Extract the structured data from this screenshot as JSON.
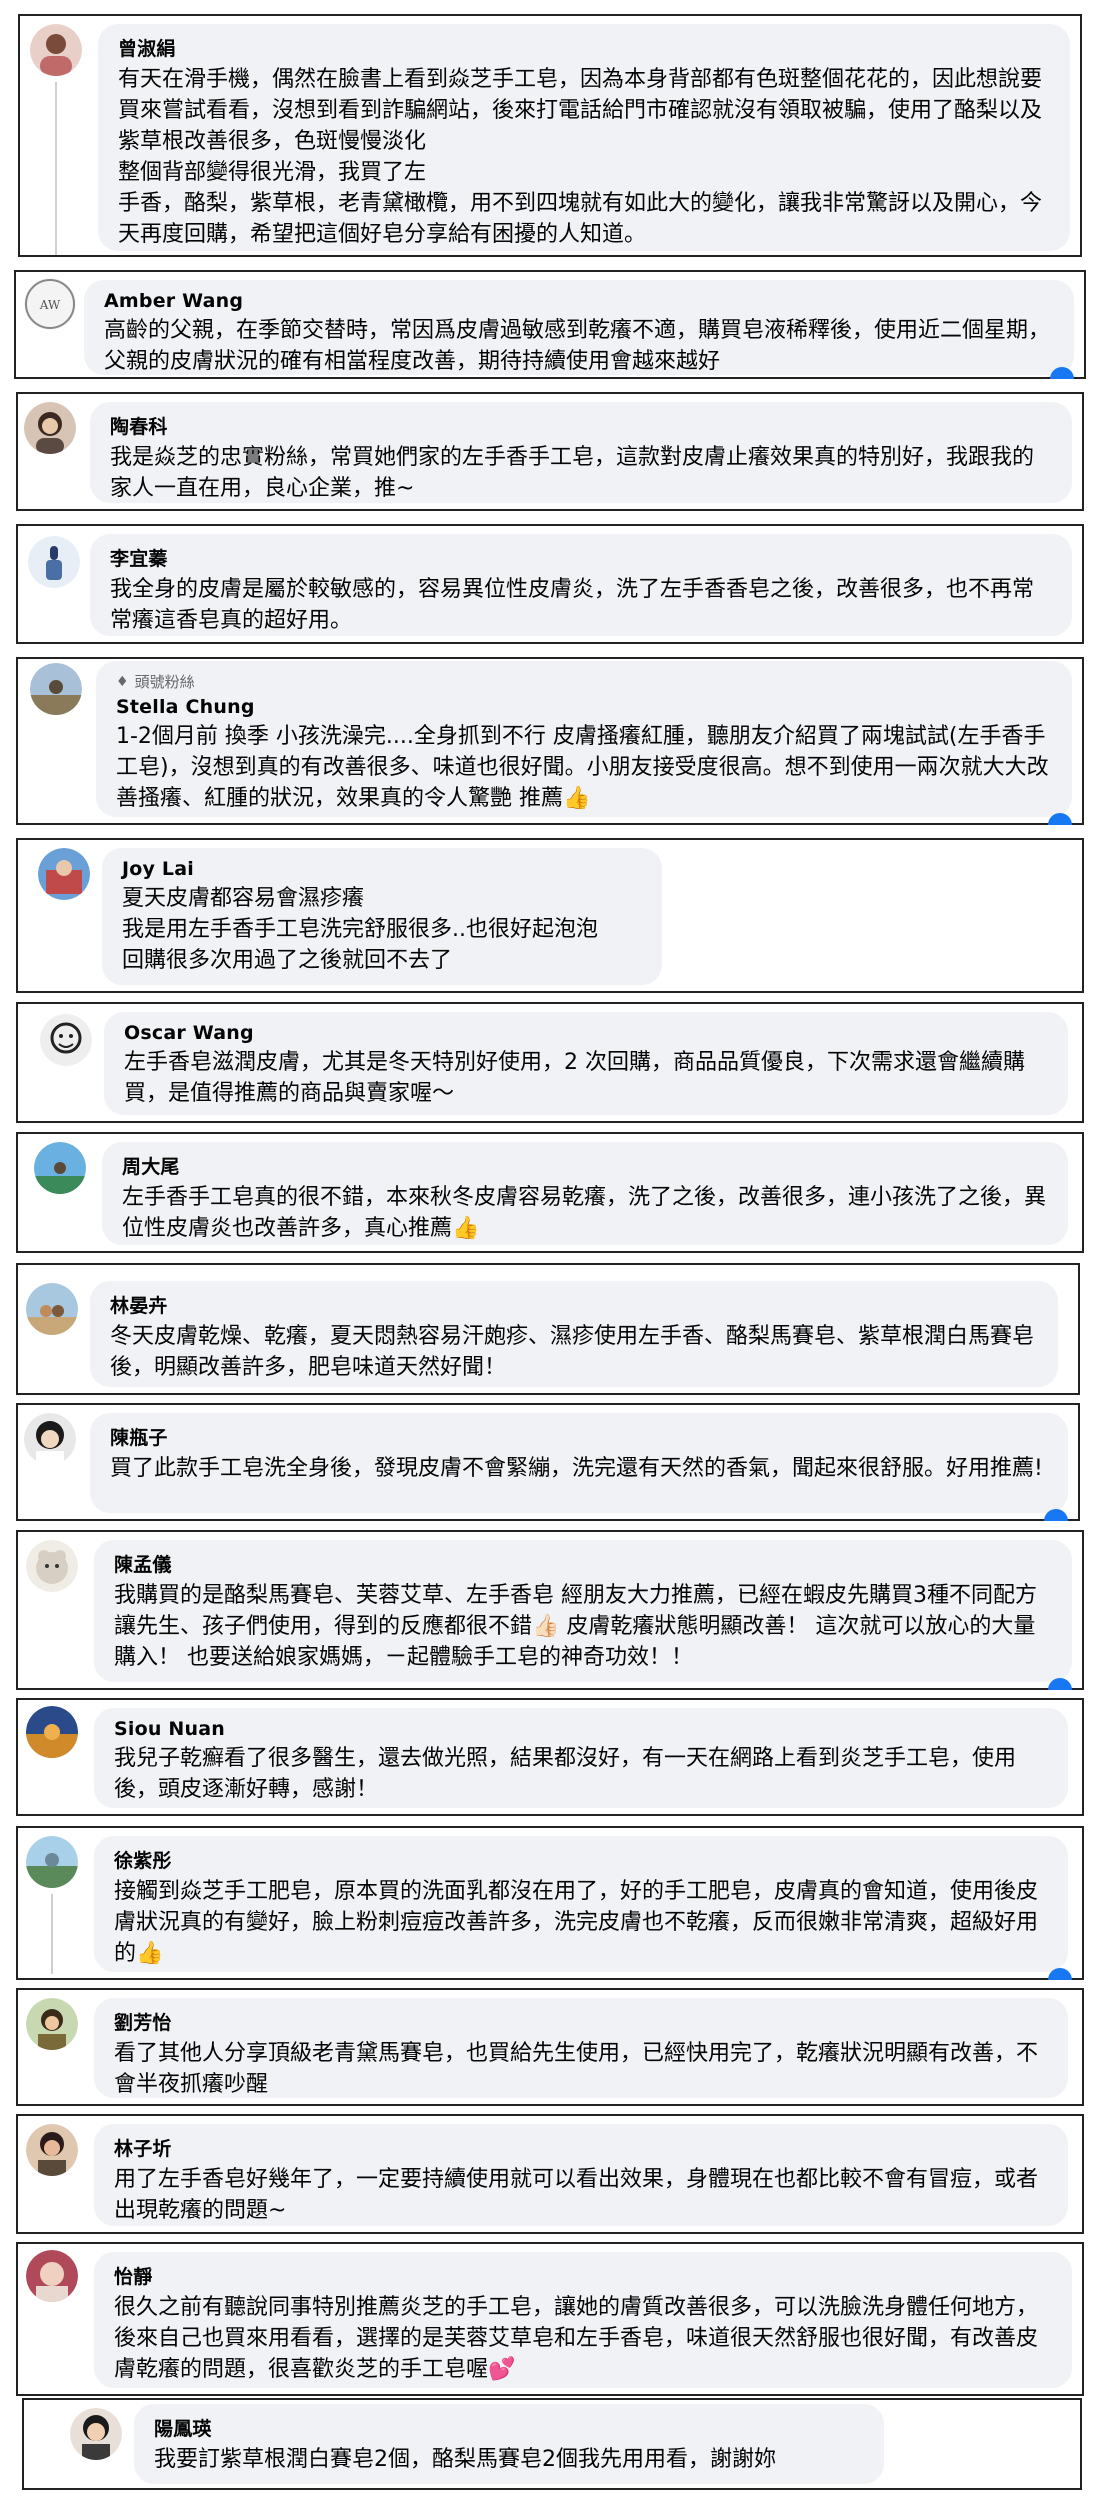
{
  "comments": [
    {
      "name": "曾淑絹",
      "badge": "",
      "text": "有天在滑手機，偶然在臉書上看到焱芝手工皂，因為本身背部都有色斑整個花花的，因此想說要買來嘗試看看，沒想到看到詐騙網站，後來打電話給門市確認就沒有領取被騙，使用了酪梨以及紫草根改善很多，色斑慢慢淡化\n整個背部變得很光滑，我買了左\n手香，酪梨，紫草根，老青黛橄欖，用不到四塊就有如此大的變化，讓我非常驚訝以及開心，今天再度回購，希望把這個好皂分享給有困擾的人知道。",
      "avatar_color": "#b87a6a"
    },
    {
      "name": "Amber Wang",
      "badge": "",
      "text": "高齡的父親，在季節交替時，常因爲皮膚過敏感到乾癢不適，購買皂液稀釋後，使用近二個星期，父親的皮膚狀況的確有相當程度改善，期待持續使用會越來越好",
      "avatar_color": "#9a9a9a"
    },
    {
      "name": "陶春科",
      "badge": "",
      "text": "我是焱芝的忠實粉絲，常買她們家的左手香手工皂，這款對皮膚止癢效果真的特別好，我跟我的家人一直在用，良心企業，推~",
      "avatar_color": "#5a4a42"
    },
    {
      "name": "李宜蓁",
      "badge": "",
      "text": "我全身的皮膚是屬於較敏感的，容易異位性皮膚炎，洗了左手香香皂之後，改善很多，也不再常常癢這香皂真的超好用。",
      "avatar_color": "#4a6fa5"
    },
    {
      "name": "Stella Chung",
      "badge": "頭號粉絲",
      "text": "1-2個月前 換季 小孩洗澡完....全身抓到不行 皮膚搔癢紅腫，聽朋友介紹買了兩塊試試(左手香手工皂)，沒想到真的有改善很多、味道也很好聞。小朋友接受度很高。想不到使用一兩次就大大改善搔癢、紅腫的狀況，效果真的令人驚艷 推薦👍",
      "avatar_color": "#8a7a5a"
    },
    {
      "name": "Joy Lai",
      "badge": "",
      "text": "夏天皮膚都容易會濕疹癢\n我是用左手香手工皂洗完舒服很多..也很好起泡泡\n回購很多次用過了之後就回不去了",
      "avatar_color": "#c04a4a"
    },
    {
      "name": "Oscar Wang",
      "badge": "",
      "text": "左手香皂滋潤皮膚，尤其是冬天特別好使用，2 次回購，商品品質優良，下次需求還會繼續購買，是值得推薦的商品與賣家喔～",
      "avatar_color": "#444444"
    },
    {
      "name": "周大尾",
      "badge": "",
      "text": "左手香手工皂真的很不錯，本來秋冬皮膚容易乾癢，洗了之後，改善很多，連小孩洗了之後，異位性皮膚炎也改善許多，真心推薦👍",
      "avatar_color": "#3a8ac0"
    },
    {
      "name": "林晏卉",
      "badge": "",
      "text": "冬天皮膚乾燥、乾癢，夏天悶熱容易汗皰疹、濕疹使用左手香、酪梨馬賽皂、紫草根潤白馬賽皂後，明顯改善許多，肥皂味道天然好聞！",
      "avatar_color": "#c08a5a"
    },
    {
      "name": "陳瓶子",
      "badge": "",
      "text": "買了此款手工皂洗全身後，發現皮膚不會緊繃，洗完還有天然的香氣，聞起來很舒服。好用推薦!",
      "avatar_color": "#2a2a2a"
    },
    {
      "name": "陳孟儀",
      "badge": "",
      "text": "我購買的是酪梨馬賽皂、芙蓉艾草、左手香皂 經朋友大力推薦，已經在蝦皮先購買3種不同配方讓先生、孩子們使用，得到的反應都很不錯👍🏻 皮膚乾癢狀態明顯改善！ 這次就可以放心的大量購入！ 也要送給娘家媽媽，ㄧ起體驗手工皂的神奇功效！！",
      "avatar_color": "#d8cfc4"
    },
    {
      "name": "Siou Nuan",
      "badge": "",
      "text": "我兒子乾癬看了很多醫生，還去做光照，結果都沒好，有一天在網路上看到炎芝手工皂，使用後，頭皮逐漸好轉，感謝！",
      "avatar_color": "#d08a2a"
    },
    {
      "name": "徐紫彤",
      "badge": "",
      "text": "接觸到焱芝手工肥皂，原本買的洗面乳都沒在用了，好的手工肥皂，皮膚真的會知道，使用後皮膚狀況真的有變好，臉上粉刺痘痘改善許多，洗完皮膚也不乾癢，反而很嫩非常清爽，超級好用的👍",
      "avatar_color": "#6a8a9a"
    },
    {
      "name": "劉芳怡",
      "badge": "",
      "text": "看了其他人分享頂級老青黛馬賽皂，也買給先生使用，已經快用完了，乾癢狀況明顯有改善，不會半夜抓癢吵醒",
      "avatar_color": "#7a6a3a"
    },
    {
      "name": "林子圻",
      "badge": "",
      "text": "用了左手香皂好幾年了，一定要持續使用就可以看出效果，身體現在也都比較不會有冒痘，或者出現乾癢的問題~",
      "avatar_color": "#5a4a3a"
    },
    {
      "name": "怡靜",
      "badge": "",
      "text": "很久之前有聽說同事特別推薦炎芝的手工皂，讓她的膚質改善很多，可以洗臉洗身體任何地方，後來自己也買來用看看，選擇的是芙蓉艾草皂和左手香皂，味道很天然舒服也很好聞，有改善皮膚乾癢的問題，很喜歡炎芝的手工皂喔💕",
      "avatar_color": "#b04a5a"
    },
    {
      "name": "陽鳳瑛",
      "badge": "",
      "text": "我要訂紫草根潤白賽皂2個，酪梨馬賽皂2個我先用用看，謝謝妳",
      "avatar_color": "#3a3a3a"
    }
  ]
}
